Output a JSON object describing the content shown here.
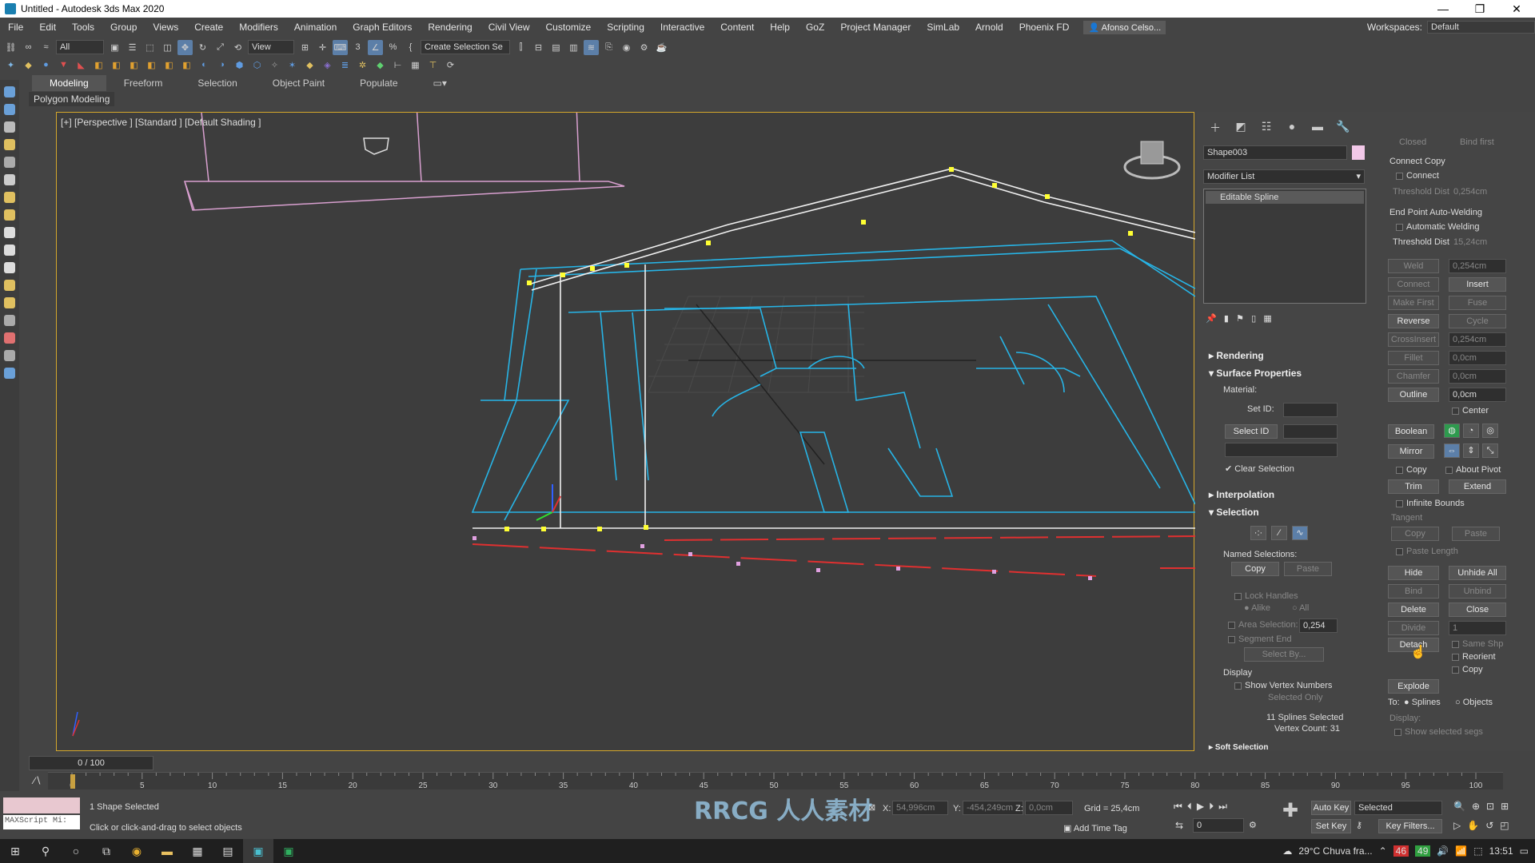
{
  "window": {
    "title": "Untitled - Autodesk 3ds Max 2020",
    "minimize": "—",
    "restore": "❐",
    "close": "✕"
  },
  "menu": [
    "File",
    "Edit",
    "Tools",
    "Group",
    "Views",
    "Create",
    "Modifiers",
    "Animation",
    "Graph Editors",
    "Rendering",
    "Civil View",
    "Customize",
    "Scripting",
    "Interactive",
    "Content",
    "Help",
    "GoZ",
    "Project Manager",
    "SimLab",
    "Arnold",
    "Phoenix FD"
  ],
  "user": "Afonso Celso...",
  "workspaces_label": "Workspaces:",
  "workspace_value": "Default",
  "toolbar": {
    "filter": "All",
    "ref_coord": "View",
    "selection_set": "Create Selection Se"
  },
  "ribbon": {
    "tabs": [
      "Modeling",
      "Freeform",
      "Selection",
      "Object Paint",
      "Populate"
    ],
    "sub": "Polygon Modeling"
  },
  "viewport": {
    "label": "[+] [Perspective ] [Standard ] [Default Shading ]"
  },
  "cmd": {
    "object_name": "Shape003",
    "object_color": "#f2c8e8",
    "modifier_list": "Modifier List",
    "stack_item": "Editable Spline",
    "rollouts": {
      "rendering": "Rendering",
      "surface": "Surface Properties",
      "interpolation": "Interpolation",
      "selection": "Selection",
      "soft": "Soft Selection"
    },
    "material_label": "Material:",
    "set_id_label": "Set ID:",
    "select_id": "Select ID",
    "clear_selection": "Clear Selection",
    "named_selections": "Named Selections:",
    "copy": "Copy",
    "paste": "Paste",
    "lock_handles": "Lock Handles",
    "alike": "Alike",
    "all": "All",
    "area_selection": "Area Selection:",
    "area_value": "0,254",
    "segment_end": "Segment End",
    "select_by": "Select By...",
    "display": "Display",
    "show_vertex_numbers": "Show Vertex Numbers",
    "selected_only": "Selected Only",
    "splines_selected": "11 Splines Selected",
    "vertex_count": "Vertex Count: 31"
  },
  "geometry": {
    "closed": "Closed",
    "bind_first": "Bind first",
    "connect_copy": "Connect Copy",
    "connect": "Connect",
    "threshold_dist": "Threshold Dist",
    "threshold1": "0,254cm",
    "endpoint_welding": "End Point Auto-Welding",
    "auto_welding": "Automatic Welding",
    "threshold2": "15,24cm",
    "weld": "Weld",
    "weld_v": "0,254cm",
    "connect_btn": "Connect",
    "insert": "Insert",
    "make_first": "Make First",
    "fuse": "Fuse",
    "reverse": "Reverse",
    "cycle": "Cycle",
    "crossinsert": "CrossInsert",
    "crossinsert_v": "0,254cm",
    "fillet": "Fillet",
    "fillet_v": "0,0cm",
    "chamfer": "Chamfer",
    "chamfer_v": "0,0cm",
    "outline": "Outline",
    "outline_v": "0,0cm",
    "center": "Center",
    "boolean": "Boolean",
    "mirror": "Mirror",
    "copy": "Copy",
    "about_pivot": "About Pivot",
    "trim": "Trim",
    "extend": "Extend",
    "infinite_bounds": "Infinite Bounds",
    "tangent": "Tangent",
    "t_copy": "Copy",
    "t_paste": "Paste",
    "paste_length": "Paste Length",
    "hide": "Hide",
    "unhide_all": "Unhide All",
    "bind": "Bind",
    "unbind": "Unbind",
    "delete": "Delete",
    "close": "Close",
    "divide": "Divide",
    "divide_v": "1",
    "detach": "Detach",
    "same_shp": "Same Shp",
    "reorient": "Reorient",
    "d_copy": "Copy",
    "explode": "Explode",
    "to": "To:",
    "splines": "Splines",
    "objects": "Objects",
    "display": "Display:",
    "show_selected_segs": "Show selected segs"
  },
  "timeline": {
    "frame": "0 / 100",
    "ticks": [
      "0",
      "5",
      "10",
      "15",
      "20",
      "25",
      "30",
      "35",
      "40",
      "45",
      "50",
      "55",
      "60",
      "65",
      "70",
      "75",
      "80",
      "85",
      "90",
      "95",
      "100"
    ]
  },
  "status": {
    "maxscript": "MAXScript Mi:",
    "shape_selected": "1 Shape Selected",
    "prompt": "Click or click-and-drag to select objects",
    "x_label": "X:",
    "x": "54,996cm",
    "y_label": "Y:",
    "y": "-454,249cm",
    "z_label": "Z:",
    "z": "0,0cm",
    "grid": "Grid = 25,4cm",
    "add_time_tag": "Add Time Tag",
    "auto_key": "Auto Key",
    "set_key": "Set Key",
    "selected": "Selected",
    "key_filters": "Key Filters...",
    "frame_field": "0"
  },
  "taskbar": {
    "weather": "29°C  Chuva fra...",
    "time": "13:51",
    "badge1": "46",
    "badge2": "49"
  },
  "watermark": "RRCG 人人素材"
}
